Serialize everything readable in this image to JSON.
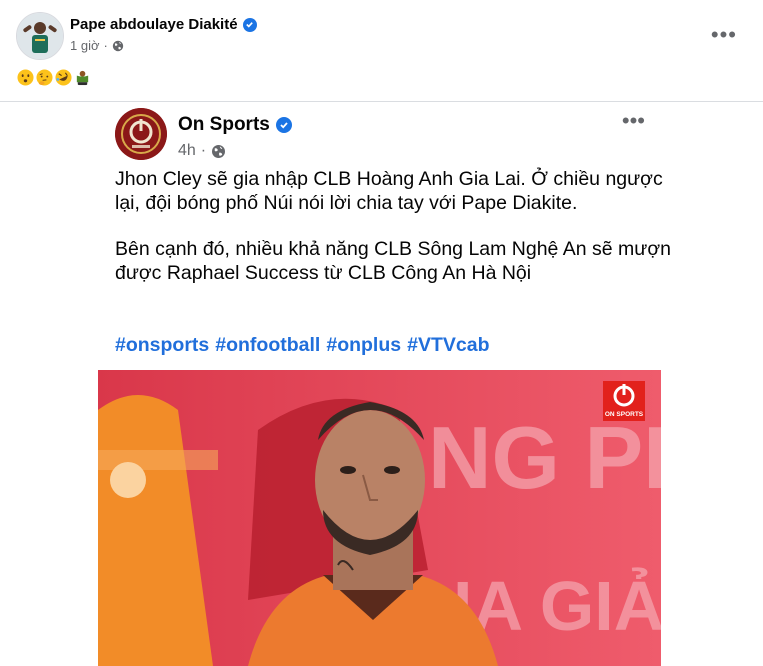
{
  "post": {
    "author_name": "Pape abdoulaye Diakité",
    "time": "1 giờ",
    "dot": "·",
    "more_label": "•••",
    "emojis": [
      "hushed-face",
      "thinking-face",
      "rolling-on-floor-laughing",
      "person-bowing"
    ]
  },
  "shared": {
    "page_name": "On Sports",
    "time": "4h",
    "dot": "·",
    "more_label": "•••",
    "paragraph_1": "Jhon Cley sẽ gia nhập CLB Hoàng Anh Gia Lai. Ở chiều ngược lại, đội bóng phố Núi nói lời chia tay với Pape Diakite.",
    "paragraph_2": "Bên cạnh đó, nhiều khả năng CLB Sông Lam Nghệ An sẽ mượn được Raphael Success từ CLB Công An Hà Nội",
    "hashtags": [
      "#onsports",
      "#onfootball",
      "#onplus",
      "#VTVcab"
    ],
    "photo": {
      "badge_text": "ON SPORTS",
      "background_text_1": "NG PH",
      "background_text_2": "IA GIẢ"
    }
  },
  "colors": {
    "link": "#216fdb",
    "verified": "#1b74e4",
    "muted": "#65676b",
    "brand": "#8b1818"
  }
}
